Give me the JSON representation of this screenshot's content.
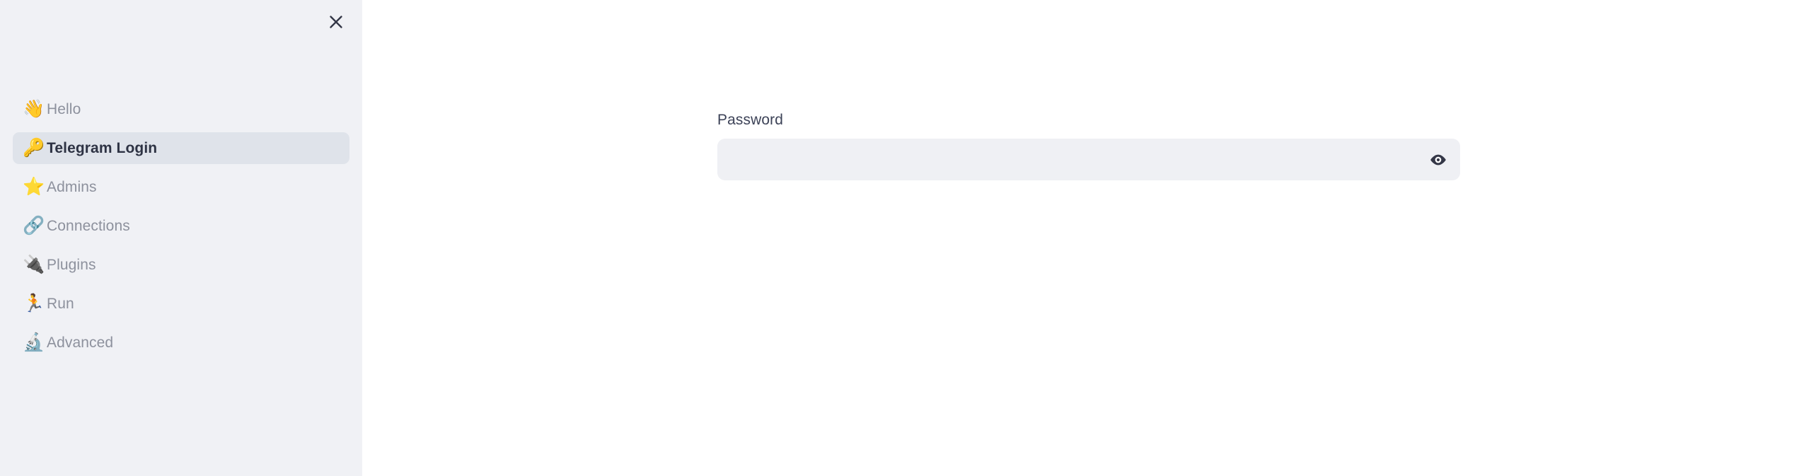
{
  "colors": {
    "sidebar_bg": "#f0f1f5",
    "main_bg": "#ffffff",
    "active_item_bg": "#dfe3ea",
    "input_bg": "#eff0f4",
    "label_text": "#3c4257",
    "inactive_text": "#8d919d",
    "active_text": "#2e3344",
    "icon_dark": "#343747"
  },
  "sidebar": {
    "close_button": {
      "label": "✕",
      "icon": "close-icon"
    },
    "items": [
      {
        "label": "Hello",
        "icon_glyph": "👋",
        "icon": "waving-hand-icon",
        "active": false
      },
      {
        "label": "Telegram Login",
        "icon_glyph": "🔑",
        "icon": "key-icon",
        "active": true
      },
      {
        "label": "Admins",
        "icon_glyph": "⭐",
        "icon": "star-icon",
        "active": false
      },
      {
        "label": "Connections",
        "icon_glyph": "🔗",
        "icon": "link-icon",
        "active": false
      },
      {
        "label": "Plugins",
        "icon_glyph": "🔌",
        "icon": "plug-icon",
        "active": false
      },
      {
        "label": "Run",
        "icon_glyph": "🏃",
        "icon": "runner-icon",
        "active": false
      },
      {
        "label": "Advanced",
        "icon_glyph": "🔬",
        "icon": "microscope-icon",
        "active": false
      }
    ]
  },
  "main": {
    "password_field": {
      "label": "Password",
      "value": "",
      "placeholder": "",
      "reveal_icon": "eye-icon"
    }
  }
}
